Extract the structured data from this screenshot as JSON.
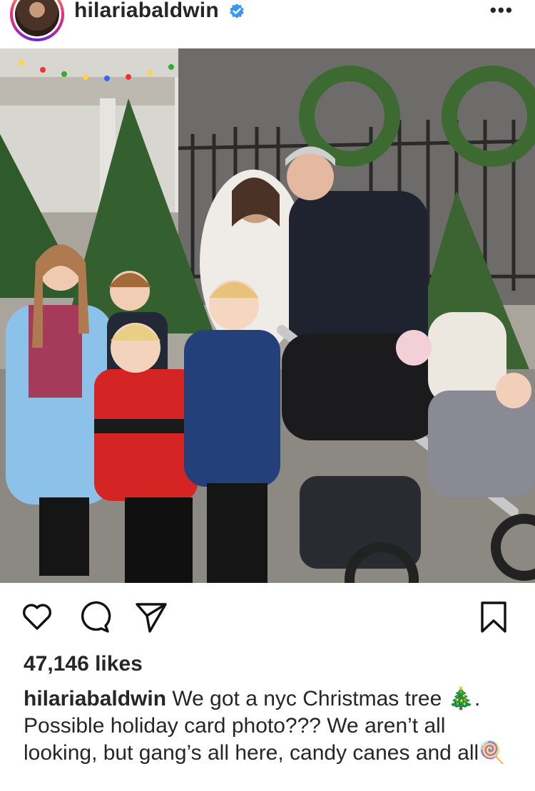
{
  "post": {
    "username": "hilariabaldwin",
    "verified_icon": "verified-badge-icon",
    "more_label": "•••",
    "likes_text": "47,146 likes",
    "caption_user": "hilariabaldwin",
    "caption_part1": "We got a nyc Christmas tree",
    "caption_emoji1": "🎄",
    "caption_part2": ". Possible holiday card photo??? We aren’t all looking, but gang’s all here, candy canes and all",
    "caption_emoji2": "🍭"
  },
  "actions": {
    "like_icon": "heart-icon",
    "comment_icon": "comment-icon",
    "share_icon": "send-icon",
    "save_icon": "bookmark-icon"
  },
  "colors": {
    "text": "#262626",
    "verified": "#3897f0",
    "ring_start": "#f9ce34",
    "ring_mid": "#ee2a7b"
  }
}
